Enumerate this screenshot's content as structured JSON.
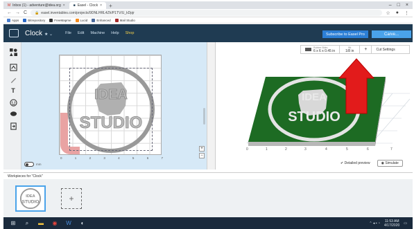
{
  "browser": {
    "tabs": [
      {
        "label": "Inbox (1) - adventure@idea.org",
        "active": false
      },
      {
        "label": "Easel - Clock",
        "active": true
      }
    ],
    "url": "easel.inventables.com/projects/9DNLHRL4Zh/P1TV/U_kDpjr",
    "bookmarks": [
      {
        "label": "Apps",
        "color": "#4a7fd1"
      },
      {
        "label": "Bitrepository",
        "color": "#2a68c5"
      },
      {
        "label": "FreeMapme",
        "color": "#333333"
      },
      {
        "label": "Lucid",
        "color": "#f58c1f"
      },
      {
        "label": "Enhanced",
        "color": "#4b6a9b"
      },
      {
        "label": "Mail Studio",
        "color": "#a52a2a"
      }
    ]
  },
  "app": {
    "title": "Clock",
    "title_suffix": "★ ⌄",
    "menu": [
      "File",
      "Edit",
      "Machine",
      "Help",
      "Shop"
    ],
    "subscribe_label": "Subscribe to Easel Pro",
    "carve_label": "Carve..."
  },
  "toolbar": {
    "tools": [
      "shapes-icon",
      "import-icon",
      "pen-icon",
      "text-icon",
      "icon-tool",
      "apps-icon",
      "import-file-icon"
    ]
  },
  "canvas": {
    "x_ticks": [
      "0",
      "1",
      "2",
      "3",
      "4",
      "5",
      "6",
      "7"
    ],
    "emblem_top_text": "IDEA",
    "emblem_bottom_text": "STUDIO",
    "toggle_label": "mm",
    "zoom_in": "+",
    "zoom_out": "−"
  },
  "material": {
    "dimensions": "6 x 6 x 0.45 in",
    "dimension_caption": "Rubber Bldrs",
    "bit_caption": "Bit",
    "bit_value": "1/8 in",
    "add_label": "+",
    "cut_settings_label": "Cut Settings"
  },
  "preview": {
    "x_ticks": [
      "0",
      "1",
      "2",
      "3",
      "4",
      "5",
      "6",
      "7"
    ],
    "detailed_preview_label": "Detailed preview",
    "simulate_label": "Simulate",
    "material_color": "#1d6b23",
    "arrow_color": "#e21b1b"
  },
  "workpieces": {
    "label": "Workpieces for \"Clock\"",
    "add_icon": "+"
  },
  "taskbar": {
    "time": "11:53 AM",
    "date": "4/17/2020",
    "items": [
      "windows-icon",
      "search-icon",
      "file-explorer-icon",
      "chrome-icon",
      "word-icon",
      "other-icon"
    ]
  }
}
